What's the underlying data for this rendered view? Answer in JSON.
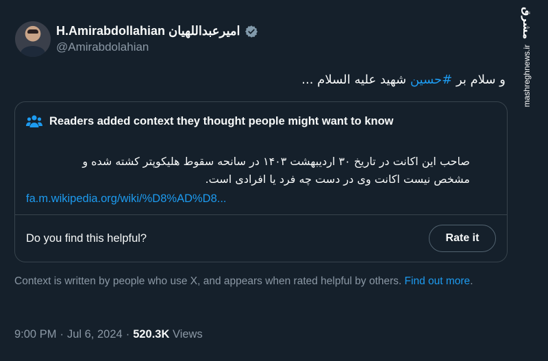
{
  "colors": {
    "background": "#15202b",
    "accent": "#1d9bf0",
    "text": "#f7f9f9",
    "muted": "#8b98a5",
    "border": "#38444d"
  },
  "author": {
    "display_name": "H.Amirabdollahian امیرعبداللهیان",
    "handle": "@Amirabdolahian",
    "avatar_icon": "avatar",
    "verified_icon": "verified-badge-icon"
  },
  "tweet": {
    "text_before": "و سلام بر ",
    "hashtag": "#حسین",
    "text_after": " شهید علیه السلام ..."
  },
  "community_note": {
    "title": "Readers added context they thought people might want to know",
    "icon": "people-icon",
    "line1": "صاحب این اکانت در تاریخ ۳۰ اردیبهشت ۱۴۰۳ در سانحه سقوط هلیکوپتر کشته شده و",
    "line2": "مشخص نیست اکانت وی در دست چه فرد یا افرادی است.",
    "link": "fa.m.wikipedia.org/wiki/%D8%AD%D8...",
    "helpful_question": "Do you find this helpful?",
    "rate_label": "Rate it"
  },
  "context_info": {
    "text": "Context is written by people who use X, and appears when rated helpful by others. ",
    "find_out_more": "Find out more",
    "period": "."
  },
  "meta": {
    "time": "9:00 PM",
    "sep1": "·",
    "date": "Jul 6, 2024",
    "sep2": "·",
    "views_count": "520.3K",
    "views_label": "Views"
  },
  "watermark": {
    "logo": "مشرق",
    "url": "mashreghnews.ir"
  }
}
